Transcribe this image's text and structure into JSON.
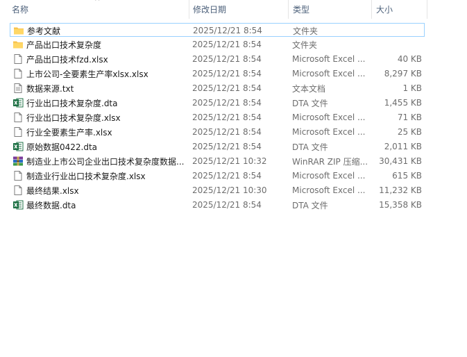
{
  "columns": {
    "name": "名称",
    "modified": "修改日期",
    "type": "类型",
    "size": "大小"
  },
  "files": [
    {
      "name": "参考文献",
      "modified": "2025/12/21 8:54",
      "type": "文件夹",
      "size": "",
      "icon": "folder-icon",
      "selected": true
    },
    {
      "name": "产品出口技术复杂度",
      "modified": "2025/12/21 8:54",
      "type": "文件夹",
      "size": "",
      "icon": "folder-icon"
    },
    {
      "name": "产品出口技术fzd.xlsx",
      "modified": "2025/12/21 8:54",
      "type": "Microsoft Excel ...",
      "size": "40 KB",
      "icon": "file-icon"
    },
    {
      "name": "上市公司-全要素生产率xlsx.xlsx",
      "modified": "2025/12/21 8:54",
      "type": "Microsoft Excel ...",
      "size": "8,297 KB",
      "icon": "file-icon"
    },
    {
      "name": "数据来源.txt",
      "modified": "2025/12/21 8:54",
      "type": "文本文档",
      "size": "1 KB",
      "icon": "text-file-icon"
    },
    {
      "name": "行业出口技术复杂度.dta",
      "modified": "2025/12/21 8:54",
      "type": "DTA 文件",
      "size": "1,455 KB",
      "icon": "excel-icon"
    },
    {
      "name": "行业出口技术复杂度.xlsx",
      "modified": "2025/12/21 8:54",
      "type": "Microsoft Excel ...",
      "size": "71 KB",
      "icon": "file-icon"
    },
    {
      "name": "行业全要素生产率.xlsx",
      "modified": "2025/12/21 8:54",
      "type": "Microsoft Excel ...",
      "size": "25 KB",
      "icon": "file-icon"
    },
    {
      "name": "原始数据0422.dta",
      "modified": "2025/12/21 8:54",
      "type": "DTA 文件",
      "size": "2,011 KB",
      "icon": "excel-icon"
    },
    {
      "name": "制造业上市公司企业出口技术复杂度数据...",
      "modified": "2025/12/21 10:32",
      "type": "WinRAR ZIP 压缩...",
      "size": "30,431 KB",
      "icon": "winrar-icon"
    },
    {
      "name": "制造业行业出口技术复杂度.xlsx",
      "modified": "2025/12/21 8:54",
      "type": "Microsoft Excel ...",
      "size": "615 KB",
      "icon": "file-icon"
    },
    {
      "name": "最终结果.xlsx",
      "modified": "2025/12/21 10:30",
      "type": "Microsoft Excel ...",
      "size": "11,232 KB",
      "icon": "file-icon"
    },
    {
      "name": "最终数据.dta",
      "modified": "2025/12/21 8:54",
      "type": "DTA 文件",
      "size": "15,358 KB",
      "icon": "excel-icon"
    }
  ]
}
